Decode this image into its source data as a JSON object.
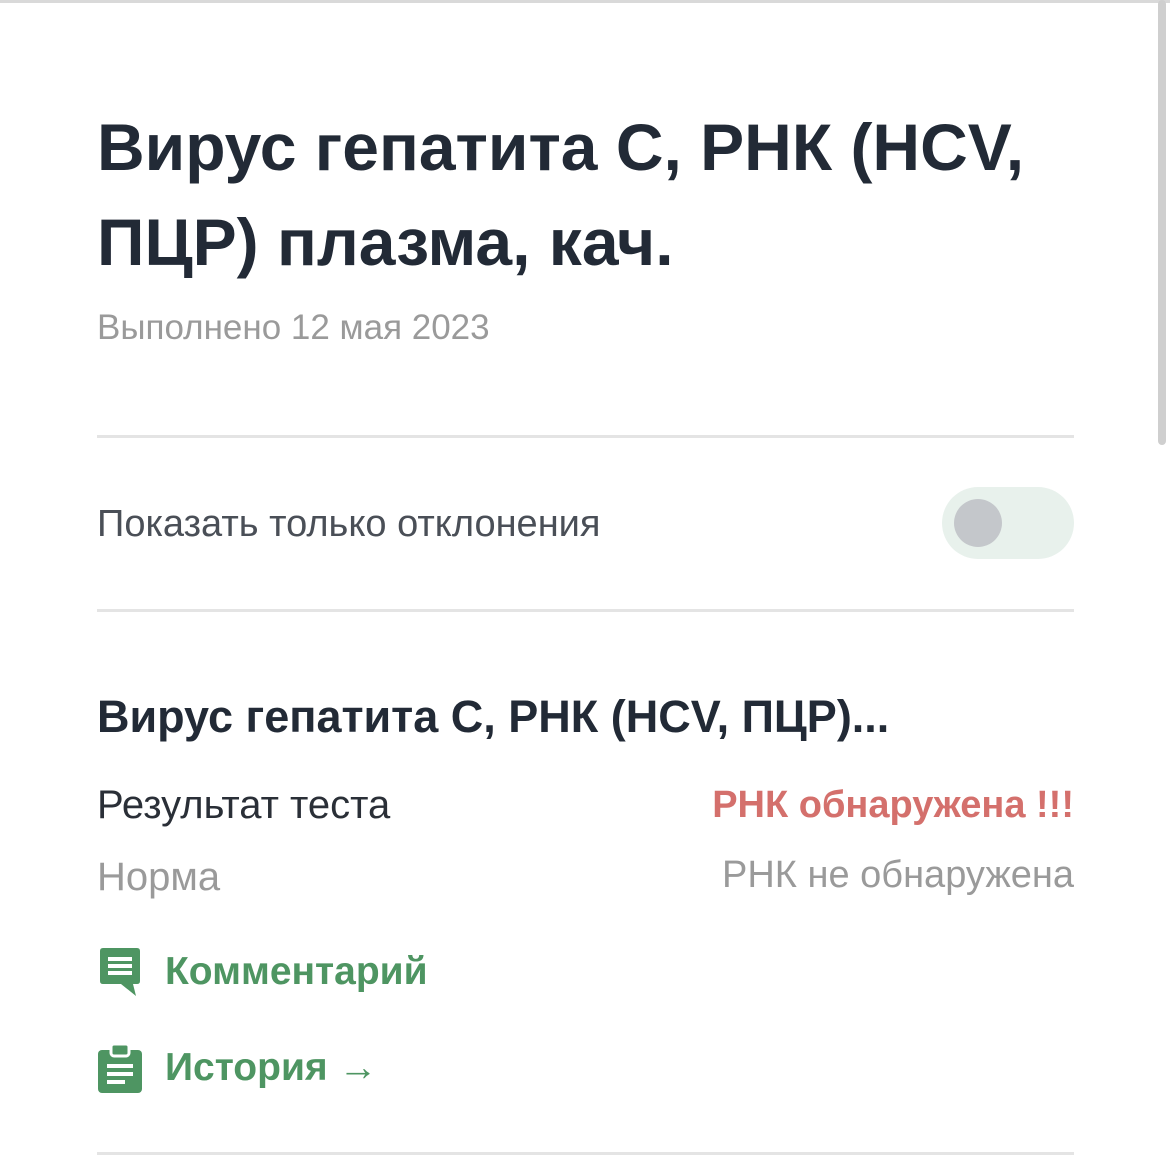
{
  "header": {
    "title": "Вирус гепатита С, РНК (HCV, ПЦР) плазма, кач.",
    "performed": "Выполнено 12 мая 2023"
  },
  "filter": {
    "label": "Показать только отклонения",
    "toggle_on": false
  },
  "test": {
    "name": "Вирус гепатита С, РНК (HCV, ПЦР)...",
    "result_label": "Результат теста",
    "result_value": "РНК обнаружена !!!",
    "norm_label": "Норма",
    "norm_value": "РНК не обнаружена"
  },
  "actions": {
    "comment_icon": "comment-icon",
    "comment_label": "Комментарий",
    "history_icon": "clipboard-icon",
    "history_label": "История →"
  },
  "colors": {
    "accent_green": "#4e9562",
    "alert_red": "#d4706c",
    "muted_gray": "#9a9a9a",
    "title_dark": "#222a36"
  }
}
